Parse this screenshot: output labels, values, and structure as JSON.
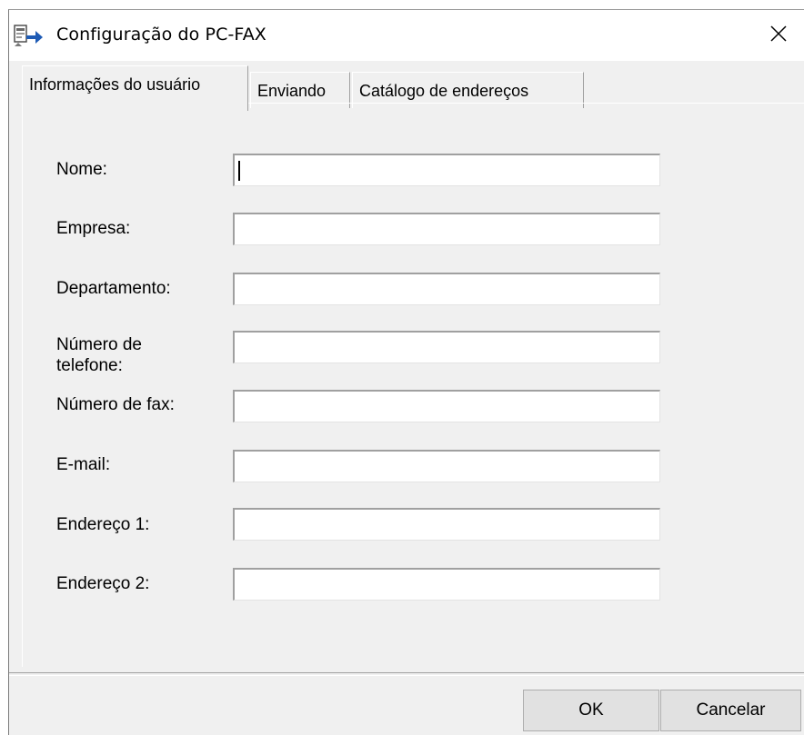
{
  "window": {
    "title": "Configuração do PC-FAX",
    "icon": "pc-fax-icon",
    "close_icon": "close-icon"
  },
  "tabs": [
    {
      "label": "Informações do usuário",
      "active": true
    },
    {
      "label": "Enviando",
      "active": false
    },
    {
      "label": "Catálogo de endereços",
      "active": false
    }
  ],
  "form": {
    "fields": [
      {
        "label": "Nome:",
        "value": ""
      },
      {
        "label": "Empresa:",
        "value": ""
      },
      {
        "label": "Departamento:",
        "value": ""
      },
      {
        "label": "Número de telefone:",
        "value": ""
      },
      {
        "label": "Número de fax:",
        "value": ""
      },
      {
        "label": "E-mail:",
        "value": ""
      },
      {
        "label": "Endereço 1:",
        "value": ""
      },
      {
        "label": "Endereço 2:",
        "value": ""
      }
    ]
  },
  "buttons": {
    "ok": "OK",
    "cancel": "Cancelar"
  }
}
